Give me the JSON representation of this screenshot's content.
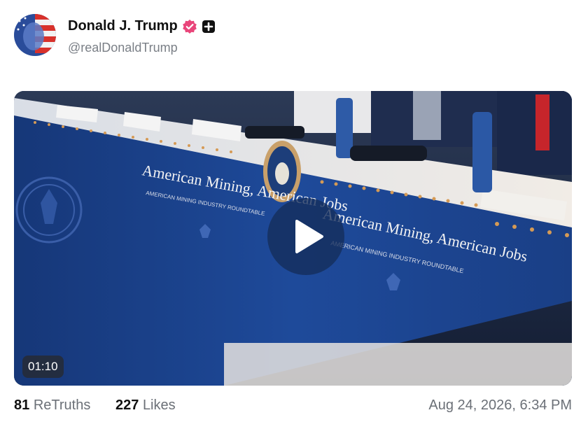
{
  "post": {
    "author": {
      "display_name": "Donald J. Trump",
      "handle": "@realDonaldTrump",
      "verified_icon": "verified-badge-icon",
      "extra_icon": "plus-badge-icon"
    },
    "media": {
      "type": "video",
      "duration": "01:10",
      "play_icon": "play-icon",
      "banner_text_primary": "American Mining, American Jobs",
      "banner_text_secondary": "AMERICAN MINING INDUSTRY ROUNDTABLE"
    },
    "stats": {
      "retruths_count": "81",
      "retruths_label": "ReTruths",
      "likes_count": "227",
      "likes_label": "Likes"
    },
    "timestamp": "Aug 24, 2026, 6:34 PM"
  },
  "colors": {
    "verified_badge": "#e9457a",
    "banner_blue": "#1c3f8a",
    "muted_text": "#6b7077"
  }
}
